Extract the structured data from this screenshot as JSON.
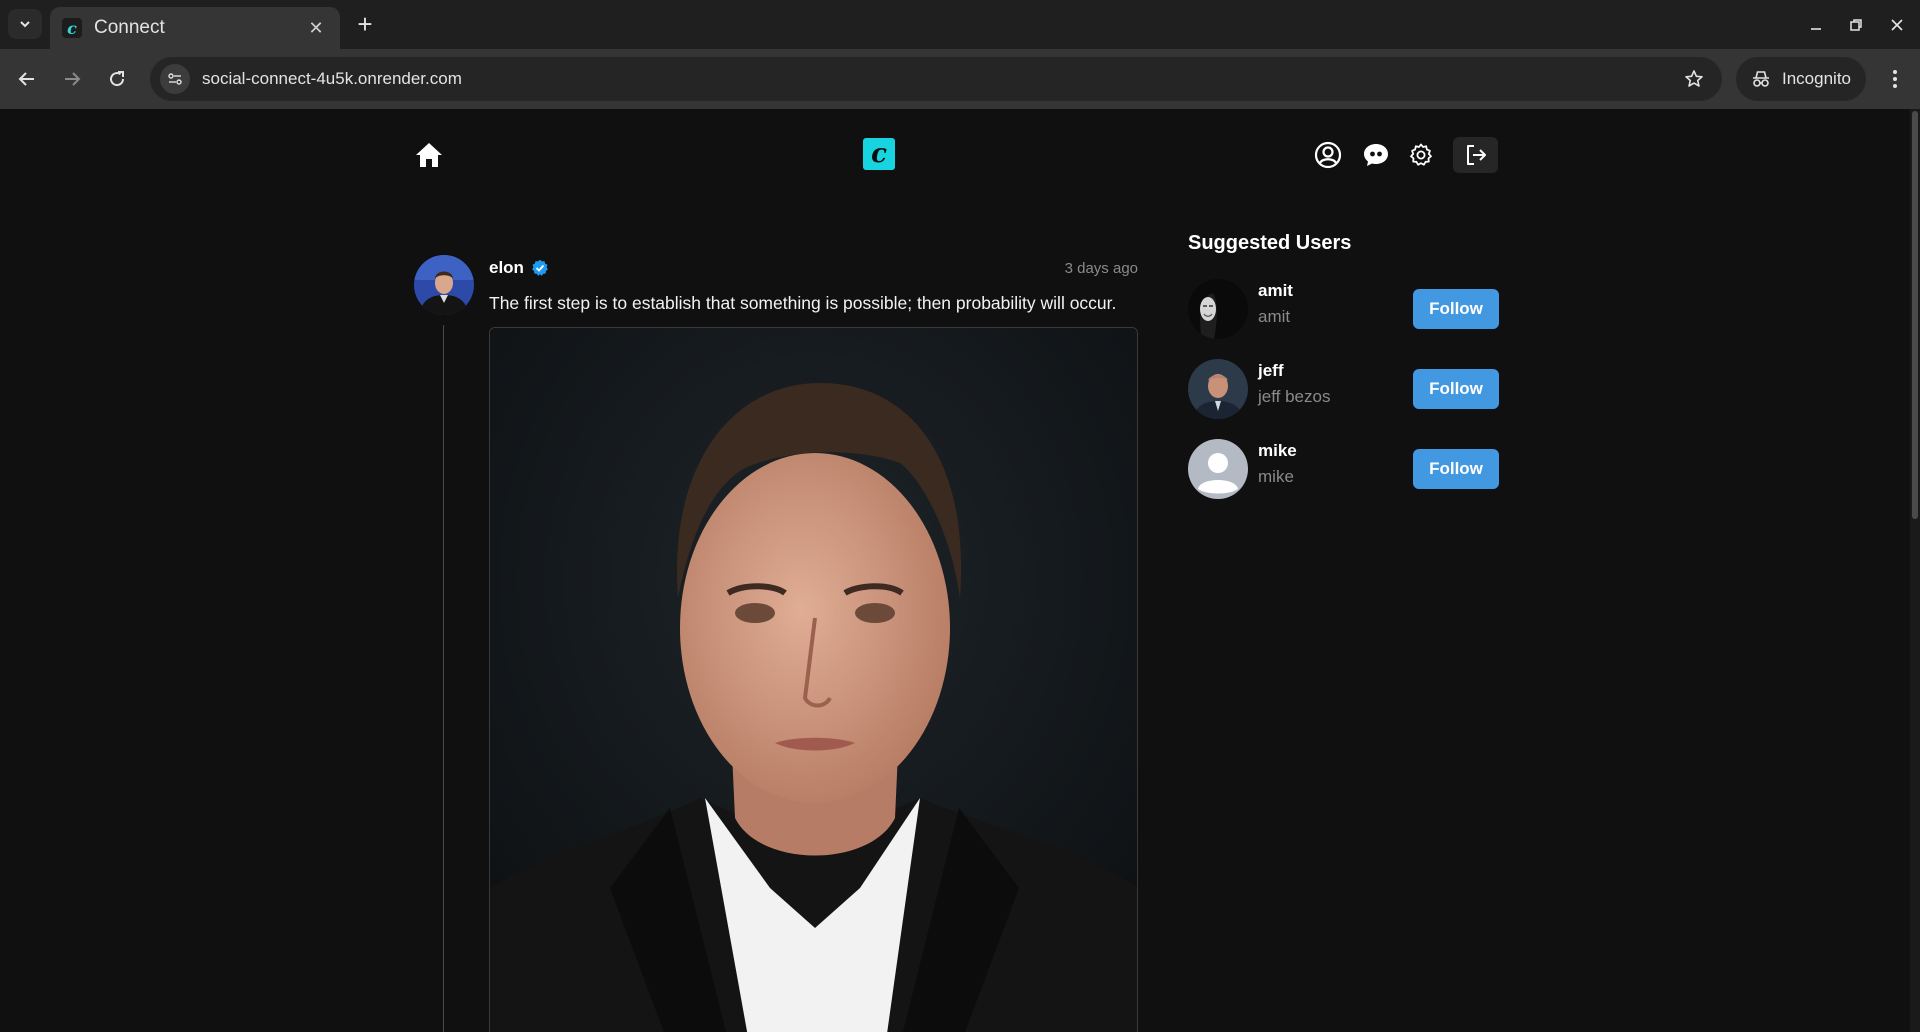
{
  "browser": {
    "tab_title": "Connect",
    "url": "social-connect-4u5k.onrender.com",
    "incognito_label": "Incognito"
  },
  "header": {
    "logo_letter": "c"
  },
  "post": {
    "username": "elon",
    "verified": true,
    "time": "3 days ago",
    "text": "The first step is to establish that something is possible; then probability will occur."
  },
  "suggested": {
    "title": "Suggested Users",
    "users": [
      {
        "username": "amit",
        "name": "amit",
        "button": "Follow"
      },
      {
        "username": "jeff",
        "name": "jeff bezos",
        "button": "Follow"
      },
      {
        "username": "mike",
        "name": "mike",
        "button": "Follow"
      }
    ]
  },
  "colors": {
    "accent": "#4299e1",
    "logo": "#17d4e0",
    "background": "#101010"
  }
}
